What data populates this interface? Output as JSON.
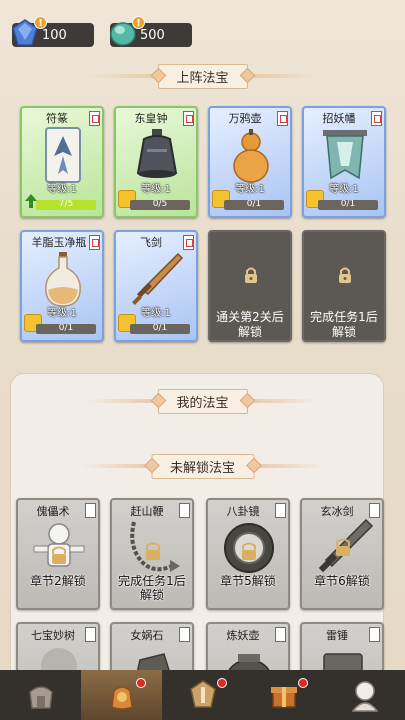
{
  "resources": [
    {
      "icon": "crystal-icon",
      "value": "100",
      "badge": "!"
    },
    {
      "icon": "jade-icon",
      "value": "500",
      "badge": "!"
    }
  ],
  "section_equipped": {
    "title": "上阵法宝"
  },
  "equipped_cards": [
    {
      "name": "符篆",
      "level": "等级:1",
      "progress": "7/5",
      "fill": 1.0,
      "rarity": "green",
      "icon": "talisman-icon"
    },
    {
      "name": "东皇钟",
      "level": "等级:1",
      "progress": "0/5",
      "fill": 0,
      "rarity": "green",
      "icon": "bell-icon"
    },
    {
      "name": "万鸦壶",
      "level": "等级:1",
      "progress": "0/1",
      "fill": 0,
      "rarity": "blue",
      "icon": "gourd-icon"
    },
    {
      "name": "招妖幡",
      "level": "等级:1",
      "progress": "0/1",
      "fill": 0,
      "rarity": "blue",
      "icon": "banner-icon"
    },
    {
      "name": "羊脂玉净瓶",
      "level": "等级:1",
      "progress": "0/1",
      "fill": 0,
      "rarity": "blue",
      "icon": "vase-icon"
    },
    {
      "name": "飞剑",
      "level": "等级:1",
      "progress": "0/1",
      "fill": 0,
      "rarity": "blue",
      "icon": "sword-icon"
    }
  ],
  "locked_slots": [
    {
      "text": "通关第2关后解锁"
    },
    {
      "text": "完成任务1后解锁"
    }
  ],
  "section_mine": {
    "title": "我的法宝"
  },
  "section_unlocked": {
    "title": "未解锁法宝"
  },
  "unowned_cards": [
    {
      "name": "傀儡术",
      "unlock": "章节2解锁",
      "icon": "puppet-icon"
    },
    {
      "name": "赶山鞭",
      "unlock": "完成任务1后解锁",
      "icon": "whip-icon"
    },
    {
      "name": "八卦镜",
      "unlock": "章节5解锁",
      "icon": "mirror-icon"
    },
    {
      "name": "玄冰剑",
      "unlock": "章节6解锁",
      "icon": "ice-sword-icon"
    },
    {
      "name": "七宝妙树",
      "unlock": "",
      "icon": "tree-icon"
    },
    {
      "name": "女娲石",
      "unlock": "",
      "icon": "stone-icon"
    },
    {
      "name": "炼妖壶",
      "unlock": "",
      "icon": "cauldron-icon"
    },
    {
      "name": "雷锤",
      "unlock": "",
      "icon": "hammer-icon"
    }
  ],
  "nav": [
    {
      "icon": "shop-icon",
      "label": "",
      "active": false,
      "dot": false
    },
    {
      "icon": "treasure-icon",
      "label": "",
      "active": true,
      "dot": true
    },
    {
      "icon": "battle-icon",
      "label": "",
      "active": false,
      "dot": true
    },
    {
      "icon": "gift-icon",
      "label": "",
      "active": false,
      "dot": true
    },
    {
      "icon": "character-icon",
      "label": "",
      "active": false,
      "dot": false
    }
  ]
}
